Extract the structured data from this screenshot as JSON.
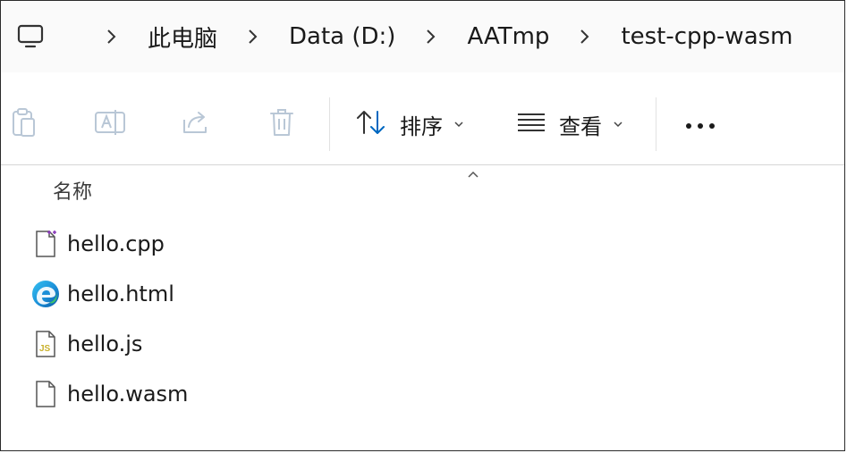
{
  "breadcrumb": {
    "items": [
      "此电脑",
      "Data (D:)",
      "AATmp",
      "test-cpp-wasm"
    ]
  },
  "toolbar": {
    "sort_label": "排序",
    "view_label": "查看"
  },
  "file_list": {
    "column_name": "名称",
    "files": [
      {
        "name": "hello.cpp",
        "icon": "cpp-file-icon"
      },
      {
        "name": "hello.html",
        "icon": "edge-icon"
      },
      {
        "name": "hello.js",
        "icon": "js-file-icon"
      },
      {
        "name": "hello.wasm",
        "icon": "blank-file-icon"
      }
    ]
  },
  "colors": {
    "accent": "#0067c0",
    "disabled_icon": "#b9c7d6",
    "cpp_badge": "#8b3dba",
    "js_badge": "#c9b12d"
  }
}
